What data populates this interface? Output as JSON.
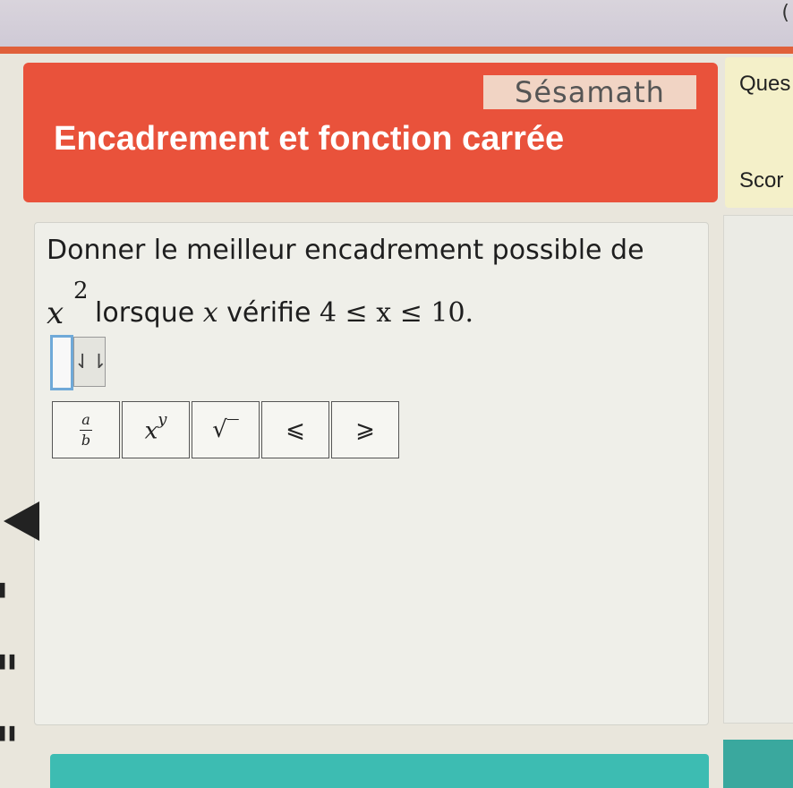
{
  "header": {
    "logo": "Sésamath",
    "title": "Encadrement et fonction carrée"
  },
  "side_panel": {
    "question_label": "Ques",
    "score_label": "Scor"
  },
  "question": {
    "line1": "Donner le meilleur encadrement possible de",
    "var": "x",
    "exponent": "2",
    "text_before": "lorsque ",
    "text_var": "x",
    "text_after": " vérifie ",
    "condition": "4 ≤ x ≤ 10."
  },
  "answer": {
    "button_glyph": "⇃⇂"
  },
  "keypad": {
    "keys": [
      {
        "name": "fraction",
        "num": "a",
        "den": "b"
      },
      {
        "name": "power",
        "base": "x",
        "exp": "y"
      },
      {
        "name": "sqrt",
        "label": "√‾"
      },
      {
        "name": "leq",
        "label": "⩽"
      },
      {
        "name": "geq",
        "label": "⩾"
      }
    ]
  },
  "nav": {
    "corner_glyph": "("
  }
}
